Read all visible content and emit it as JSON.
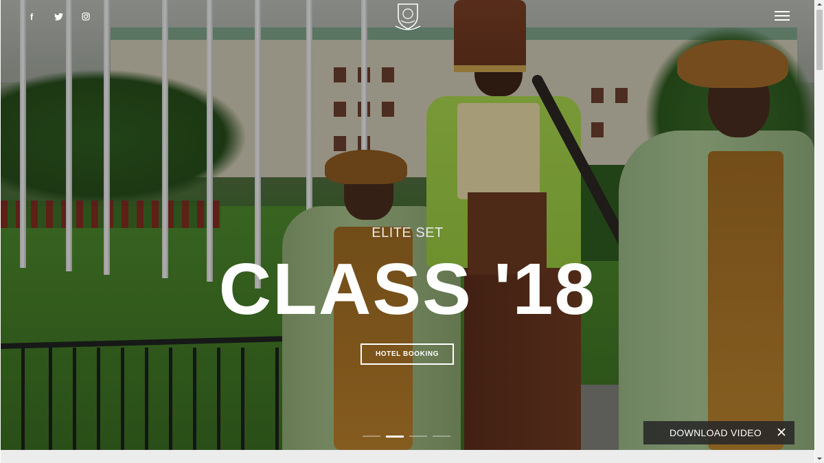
{
  "header": {
    "social": [
      {
        "icon": "facebook-icon",
        "glyph": "f"
      },
      {
        "icon": "twitter-icon",
        "glyph": "🐦"
      },
      {
        "icon": "instagram-icon",
        "glyph": "◎"
      }
    ],
    "logo": "crest-logo",
    "menu_icon": "hamburger-menu-icon"
  },
  "hero": {
    "eyebrow": "ELITE SET",
    "title": "CLASS '18",
    "cta_label": "HOTEL BOOKING",
    "slides": 4,
    "active_slide": 2
  },
  "download": {
    "label": "DOWNLOAD VIDEO",
    "close_icon": "close-icon"
  },
  "colors": {
    "overlay": "#000000",
    "text": "#ffffff",
    "download_bg": "#282828"
  }
}
